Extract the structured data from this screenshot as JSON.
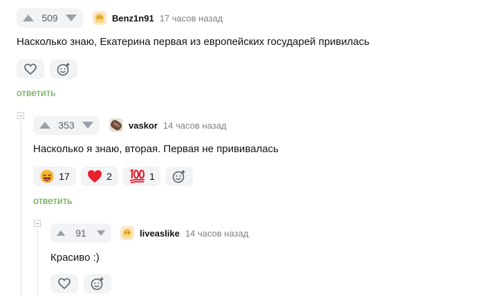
{
  "comments": [
    {
      "rating": "509",
      "author": "Benz1n91",
      "time": "17 часов назад",
      "text": "Насколько знаю, Екатерина первая из европейских государей привилась",
      "reply_label": "ответить"
    },
    {
      "rating": "353",
      "author": "vaskor",
      "time": "14 часов назад",
      "text": "Насколько я знаю, вторая. Первая не прививалась",
      "reactions": [
        {
          "icon": "laughing-emoji-icon",
          "count": "17"
        },
        {
          "icon": "red-heart-icon",
          "count": "2"
        },
        {
          "icon": "hundred-points-icon",
          "count": "1"
        }
      ],
      "reply_label": "ответить"
    },
    {
      "rating": "91",
      "author": "liveaslike",
      "time": "14 часов назад",
      "text": "Красиво :)"
    }
  ],
  "colors": {
    "accent_green": "#5aa23d",
    "pill_bg": "#f1f3f5",
    "arrow_gray": "#9aa0a6",
    "heart_red": "#e8212e"
  }
}
